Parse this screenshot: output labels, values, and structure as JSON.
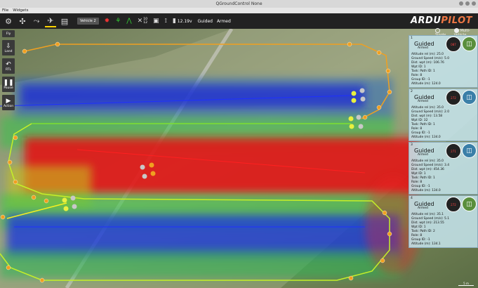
{
  "window": {
    "title": "QGroundControl None"
  },
  "menu": {
    "file": "File",
    "widgets": "Widgets"
  },
  "toolbar": {
    "vehicle": "Vehicle 2",
    "gps_count": "12",
    "gps_sats": "10",
    "battery": "12.19v",
    "flight_mode": "Guided",
    "armed_status": "Armed",
    "brand_part1": "ARDU",
    "brand_part2": "PILOT"
  },
  "leftbar": {
    "fly": "Fly",
    "land": "Land",
    "rtl": "RTL",
    "pause": "Pause",
    "action": "Action"
  },
  "view_mode": {
    "single": "Single",
    "multi": "Multi-Vehicle"
  },
  "vehicles": [
    {
      "index": "1",
      "mode": "Guided",
      "armed": "Armed",
      "heading": "087",
      "rows": [
        "Altitude rel (m): 25.0",
        "Ground Speed (m/s): 5.0",
        "Dist. wpt (m): 106.76",
        "Wpt ID: 1",
        "Task: Path ID: 1",
        "Role: 8",
        "Group ID: -1",
        "Altitude (m): 124.0"
      ]
    },
    {
      "index": "2",
      "mode": "Guided",
      "armed": "Armed",
      "heading": "272",
      "rows": [
        "Altitude rel (m): 35.0",
        "Ground Speed (m/s): 2.0",
        "Dist. wpt (m): 13.58",
        "Wpt ID: 32",
        "Task: Path ID: 1",
        "Role: 8",
        "Group ID: -1",
        "Altitude (m): 134.0"
      ]
    },
    {
      "index": "3",
      "mode": "Guided",
      "armed": "Armed",
      "heading": "271",
      "rows": [
        "Altitude rel (m): 35.0",
        "Ground Speed (m/s): 3.4",
        "Dist. wpt (m): 454.36",
        "Wpt ID: 1",
        "Task: Path ID: 1",
        "Role: 8",
        "Group ID: -1",
        "Altitude (m): 134.0"
      ]
    },
    {
      "index": "4",
      "mode": "Guided",
      "armed": "Armed",
      "heading": "272",
      "rows": [
        "Altitude rel (m): 35.1",
        "Ground Speed (m/s): 5.1",
        "Dist. wpt (m): 213.55",
        "Wpt ID: 1",
        "Task: Path ID: 2",
        "Role: 8",
        "Group ID: -1",
        "Altitude (m): 134.1"
      ]
    }
  ],
  "map": {
    "scale": "5 m"
  }
}
